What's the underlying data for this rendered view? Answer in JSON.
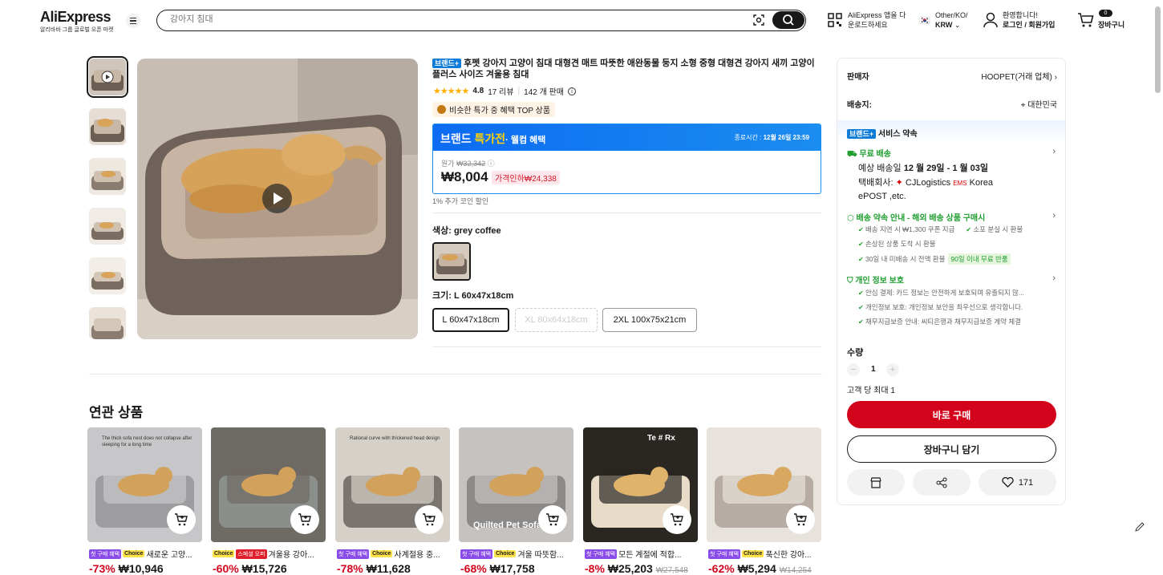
{
  "header": {
    "logo": "AliExpress",
    "logo_sub": "알리바바 그룹 글로벌 오픈 마켓",
    "search_placeholder": "강아지 침대",
    "app_line1": "AliExpress 앱을 다",
    "app_line2": "운로드하세요",
    "region_line1": "Other/KO/",
    "region_line2": "KRW",
    "login_line1": "환영합니다!",
    "login_line2": "로그인 / 회원가입",
    "cart_count": "0",
    "cart_label": "장바구니"
  },
  "product": {
    "brand_tag": "브랜드+",
    "title": "후펫 강아지 고양이 침대 대형견 매트 따뜻한 애완동물 둥지 소형 중형 대형견 강아지 새끼 고양이 플러스 사이즈 겨울용 침대",
    "rating": "4.8",
    "reviews": "17 리뷰",
    "sold": "142 개 판매",
    "top_badge": "비슷한 특가 중 혜택 TOP 상품",
    "deal_title_a": "브랜드 ",
    "deal_title_b": "특가전",
    "deal_title_c": "· 웰컴 혜택",
    "deal_end_label": "종료시간 :",
    "deal_end_value": "12월 26일 23:59",
    "orig_label": "원가 ",
    "orig_price": "₩32,342",
    "price": "₩8,004",
    "discount": "가격인하₩24,338",
    "coin": "1% 추가 코인 할인",
    "color_label": "색상: grey coffee",
    "size_label": "크기: L 60x47x18cm",
    "sizes": [
      "L 60x47x18cm",
      "XL 80x64x18cm",
      "2XL 100x75x21cm"
    ]
  },
  "panel": {
    "seller_label": "판매자",
    "seller_value": "HOOPET(거래 업체)",
    "ship_to_label": "배송지:",
    "ship_to_value": "대한민국",
    "service_tag": "브랜드+",
    "service_label": "서비스 약속",
    "free_ship": "무료 배송",
    "delivery_prefix": "예상 배송일 ",
    "delivery_date": "12 월 29일 - 1 월 03일",
    "carrier_label": "택배회사:",
    "carrier1": "CJLogistics",
    "carrier2": "Korea",
    "carrier3": "ePOST ,etc.",
    "promise_title": "배송 약속 안내 - 해외 배송 상품 구매시",
    "promise_items": [
      "배송 지연 시 ₩1,300 쿠폰 지급",
      "소포 분실 시 환불",
      "손상된 상품 도착 시 환불",
      "30일 내 미배송 시 전액 환불"
    ],
    "promise_badge": "90일 이내 무료 반품",
    "privacy_title": "개인 정보 보호",
    "privacy_items": [
      "안심 결제: 카드 정보는 안전하게 보호되며 유출되지 않...",
      "개인정보 보호: 개인정보 보안을 최우선으로 생각합니다.",
      "채무지급보증 안내: 씨티은행과 채무지급보증 계약 체결"
    ],
    "qty_label": "수량",
    "qty_value": "1",
    "qty_max": "고객 당 최대 1",
    "buy_now": "바로 구매",
    "add_cart": "장바구니 담기",
    "wish_count": "171"
  },
  "related": {
    "title": "연관 상품",
    "items": [
      {
        "tag1": "첫 구매 혜택",
        "tag2": "Choice",
        "name": "새로운 고양...",
        "pct": "-73%",
        "price": "₩10,946",
        "orig": ""
      },
      {
        "tag1": "Choice",
        "tag2": "스페셜 오퍼",
        "name": "겨울용 강아...",
        "pct": "-60%",
        "price": "₩15,726",
        "orig": ""
      },
      {
        "tag1": "첫 구매 혜택",
        "tag2": "Choice",
        "name": "사계절용 중...",
        "pct": "-78%",
        "price": "₩11,628",
        "orig": ""
      },
      {
        "tag1": "첫 구매 혜택",
        "tag2": "Choice",
        "name": "겨울 따뜻함...",
        "pct": "-68%",
        "price": "₩17,758",
        "orig": ""
      },
      {
        "tag1": "첫 구매 혜택",
        "tag2": "",
        "name": "모든 계절에 적합...",
        "pct": "-8%",
        "price": "₩25,203",
        "orig": "₩27,548"
      },
      {
        "tag1": "첫 구매 혜택",
        "tag2": "Choice",
        "name": "푹신한 강아...",
        "pct": "-62%",
        "price": "₩5,294",
        "orig": "₩14,254"
      }
    ],
    "img_texts": [
      "The thick sofa nest does not collapse after sleeping for a long time",
      "",
      "Rational curve with thickened head design",
      "Quilted Pet Sofa",
      "Te # Rx",
      ""
    ]
  }
}
